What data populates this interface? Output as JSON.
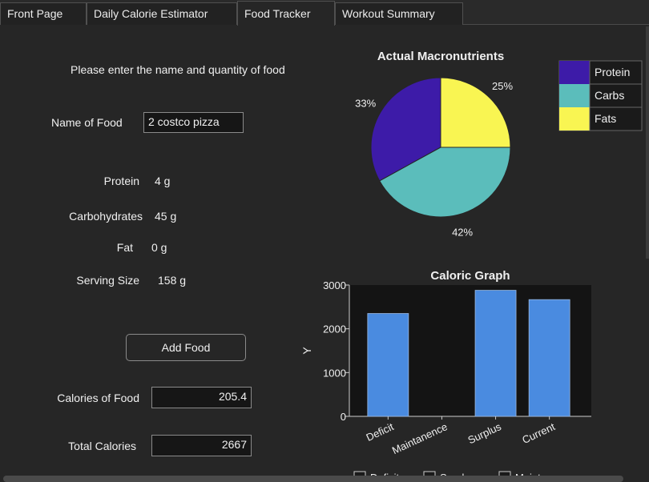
{
  "tabs": [
    "Front Page",
    "Daily Calorie Estimator",
    "Food Tracker",
    "Workout Summary"
  ],
  "active_tab": "Food Tracker",
  "form": {
    "prompt": "Please enter the name and quantity of food",
    "name_label": "Name of Food",
    "name_value": "2 costco pizza",
    "protein_label": "Protein",
    "protein_value": "4 g",
    "carbs_label": "Carbohydrates",
    "carbs_value": "45 g",
    "fat_label": "Fat",
    "fat_value": "0 g",
    "serving_label": "Serving Size",
    "serving_value": "158 g",
    "add_button": "Add Food",
    "food_calories_label": "Calories of Food",
    "food_calories_value": "205.4",
    "total_calories_label": "Total Calories",
    "total_calories_value": "2667"
  },
  "chart_data": [
    {
      "type": "pie",
      "title": "Actual Macronutrients",
      "labels": [
        "Protein",
        "Carbs",
        "Fats"
      ],
      "values": [
        33,
        42,
        25
      ],
      "value_labels": [
        "33%",
        "42%",
        "25%"
      ],
      "colors": [
        "#3d1ba8",
        "#5bbdbb",
        "#f9f552"
      ],
      "legend": "top-right"
    },
    {
      "type": "bar",
      "title": "Caloric Graph",
      "categories": [
        "Deficit",
        "Maintanence",
        "Surplus",
        "Current"
      ],
      "values": [
        2350,
        0,
        2880,
        2667
      ],
      "ylabel": "Y",
      "ylim": [
        0,
        3000
      ],
      "yticks": [
        0,
        1000,
        2000,
        3000
      ],
      "ytick_labels": [
        "0",
        "1000",
        "2000",
        "3000"
      ],
      "bar_color": "#4a8be0",
      "grid": false
    }
  ],
  "bar_legend_partial": [
    "Deficit",
    "Surplus",
    "Maint"
  ]
}
